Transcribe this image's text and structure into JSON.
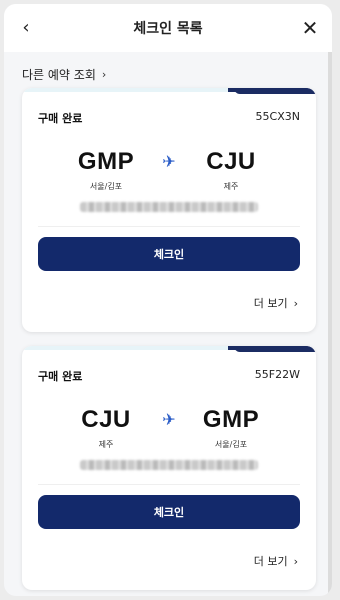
{
  "header": {
    "title": "체크인 목록",
    "back_icon": "chevron-left-icon",
    "close_icon": "close-icon"
  },
  "links": {
    "other_reservation": "다른 예약 조회"
  },
  "colors": {
    "primary": "#13296b",
    "plane": "#2a5cc7"
  },
  "bookings": [
    {
      "status": "구매 완료",
      "pnr": "55CX3N",
      "from_code": "GMP",
      "from_city": "서울/김포",
      "to_code": "CJU",
      "to_city": "제주",
      "checkin_label": "체크인",
      "more_label": "더 보기"
    },
    {
      "status": "구매 완료",
      "pnr": "55F22W",
      "from_code": "CJU",
      "from_city": "제주",
      "to_code": "GMP",
      "to_city": "서울/김포",
      "checkin_label": "체크인",
      "more_label": "더 보기"
    }
  ]
}
